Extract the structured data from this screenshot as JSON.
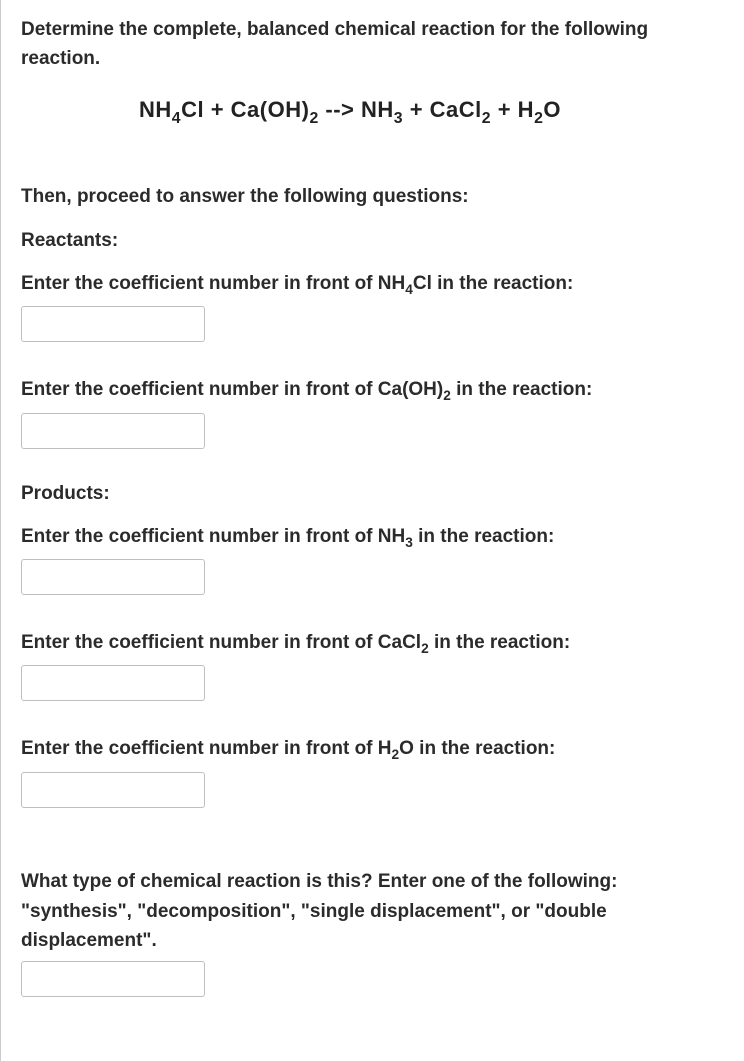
{
  "intro": "Determine the complete, balanced chemical reaction for the following reaction.",
  "then_line": "Then, proceed to answer the following questions:",
  "reactants_head": "Reactants:",
  "products_head": "Products:",
  "q_nh4cl_pre": "Enter the coefficient number in front of NH",
  "q_nh4cl_sub": "4",
  "q_nh4cl_post": "Cl in the reaction:",
  "q_caoh2_pre": "Enter the coefficient number in front of Ca(OH)",
  "q_caoh2_sub": "2",
  "q_caoh2_post": " in the reaction:",
  "q_nh3_pre": "Enter the coefficient number in front of NH",
  "q_nh3_sub": "3",
  "q_nh3_post": " in the reaction:",
  "q_cacl2_pre": "Enter the coefficient number in front of CaCl",
  "q_cacl2_sub": "2",
  "q_cacl2_post": " in the reaction:",
  "q_h2o_pre": "Enter the coefficient number in front of H",
  "q_h2o_sub": "2",
  "q_h2o_post": "O in the reaction:",
  "type_q_line1": "What type of chemical reaction is this?  Enter one of the following:",
  "type_q_line2": "\"synthesis\", \"decomposition\", \"single displacement\", or \"double displacement\".",
  "eq": {
    "t1": "NH",
    "s1": "4",
    "t2": "Cl  +  Ca(OH)",
    "s2": "2",
    "t3": "  -->  NH",
    "s3": "3",
    "t4": "  +  CaCl",
    "s4": "2",
    "t5": "  +  H",
    "s5": "2",
    "t6": "O"
  }
}
